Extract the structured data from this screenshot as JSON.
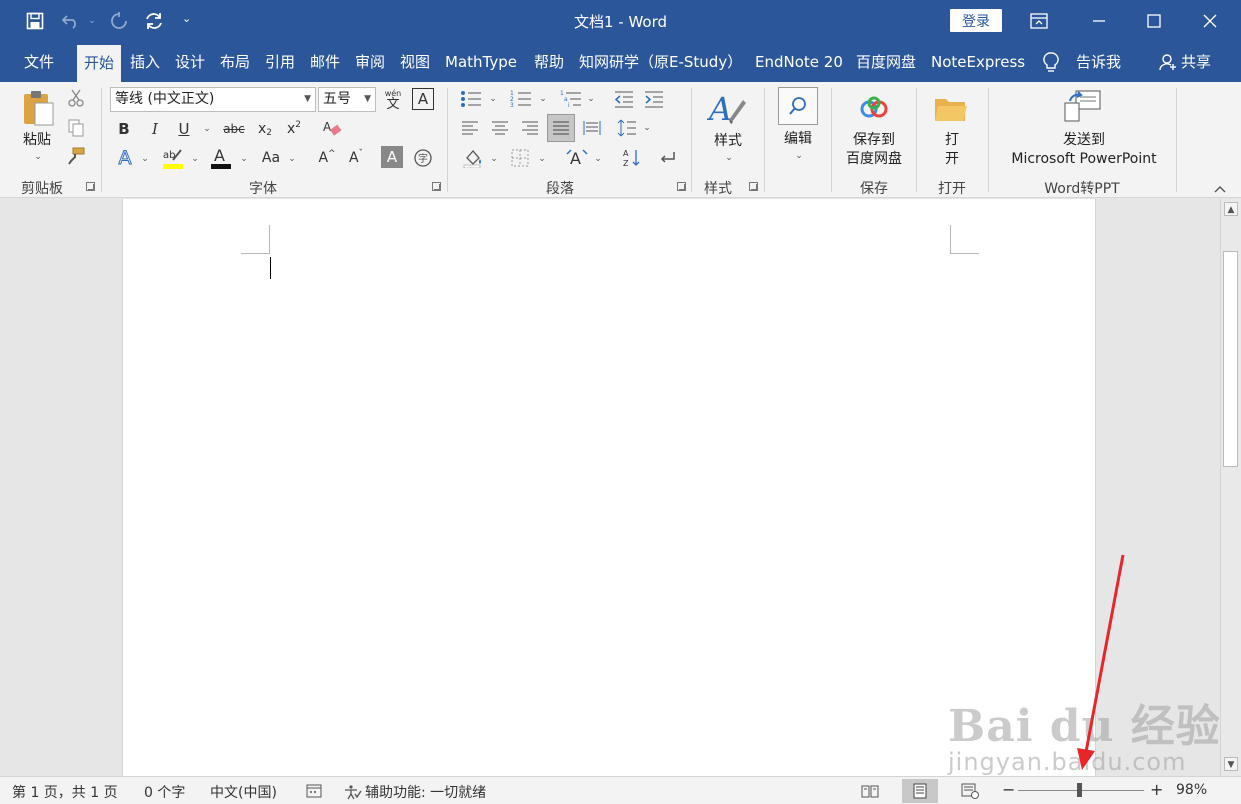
{
  "window": {
    "title": "文档1  -  Word",
    "login_label": "登录"
  },
  "tabs": [
    {
      "label": "文件"
    },
    {
      "label": "开始"
    },
    {
      "label": "插入"
    },
    {
      "label": "设计"
    },
    {
      "label": "布局"
    },
    {
      "label": "引用"
    },
    {
      "label": "邮件"
    },
    {
      "label": "审阅"
    },
    {
      "label": "视图"
    },
    {
      "label": "MathType"
    },
    {
      "label": "帮助"
    },
    {
      "label": "知网研学（原E-Study）"
    },
    {
      "label": "EndNote 20"
    },
    {
      "label": "百度网盘"
    },
    {
      "label": "NoteExpress"
    },
    {
      "label": "告诉我"
    }
  ],
  "share_label": "共享",
  "ribbon": {
    "clipboard": {
      "label": "剪贴板",
      "paste_label": "粘贴"
    },
    "font": {
      "label": "字体",
      "font_name": "等线 (中文正文)",
      "font_size": "五号",
      "phonetic": "wén"
    },
    "paragraph": {
      "label": "段落"
    },
    "styles": {
      "label": "样式",
      "styles_button": "样式"
    },
    "editing": {
      "label": "编辑"
    },
    "save": {
      "label": "保存",
      "button_line1": "保存到",
      "button_line2": "百度网盘"
    },
    "open": {
      "label": "打开",
      "button_line1": "打",
      "button_line2": "开"
    },
    "word_to_ppt": {
      "label": "Word转PPT",
      "button_line1": "发送到",
      "button_line2": "Microsoft PowerPoint"
    }
  },
  "status": {
    "page": "第 1 页，共 1 页",
    "words": "0 个字",
    "language": "中文(中国)",
    "accessibility": "辅助功能: 一切就绪",
    "zoom": "98%",
    "zoom_fraction": 0.49
  },
  "watermark": {
    "main": "Bai du 经验",
    "sub": "jingyan.baidu.com"
  },
  "colors": {
    "accent": "#2b579a",
    "annotation": "#e8262a"
  }
}
